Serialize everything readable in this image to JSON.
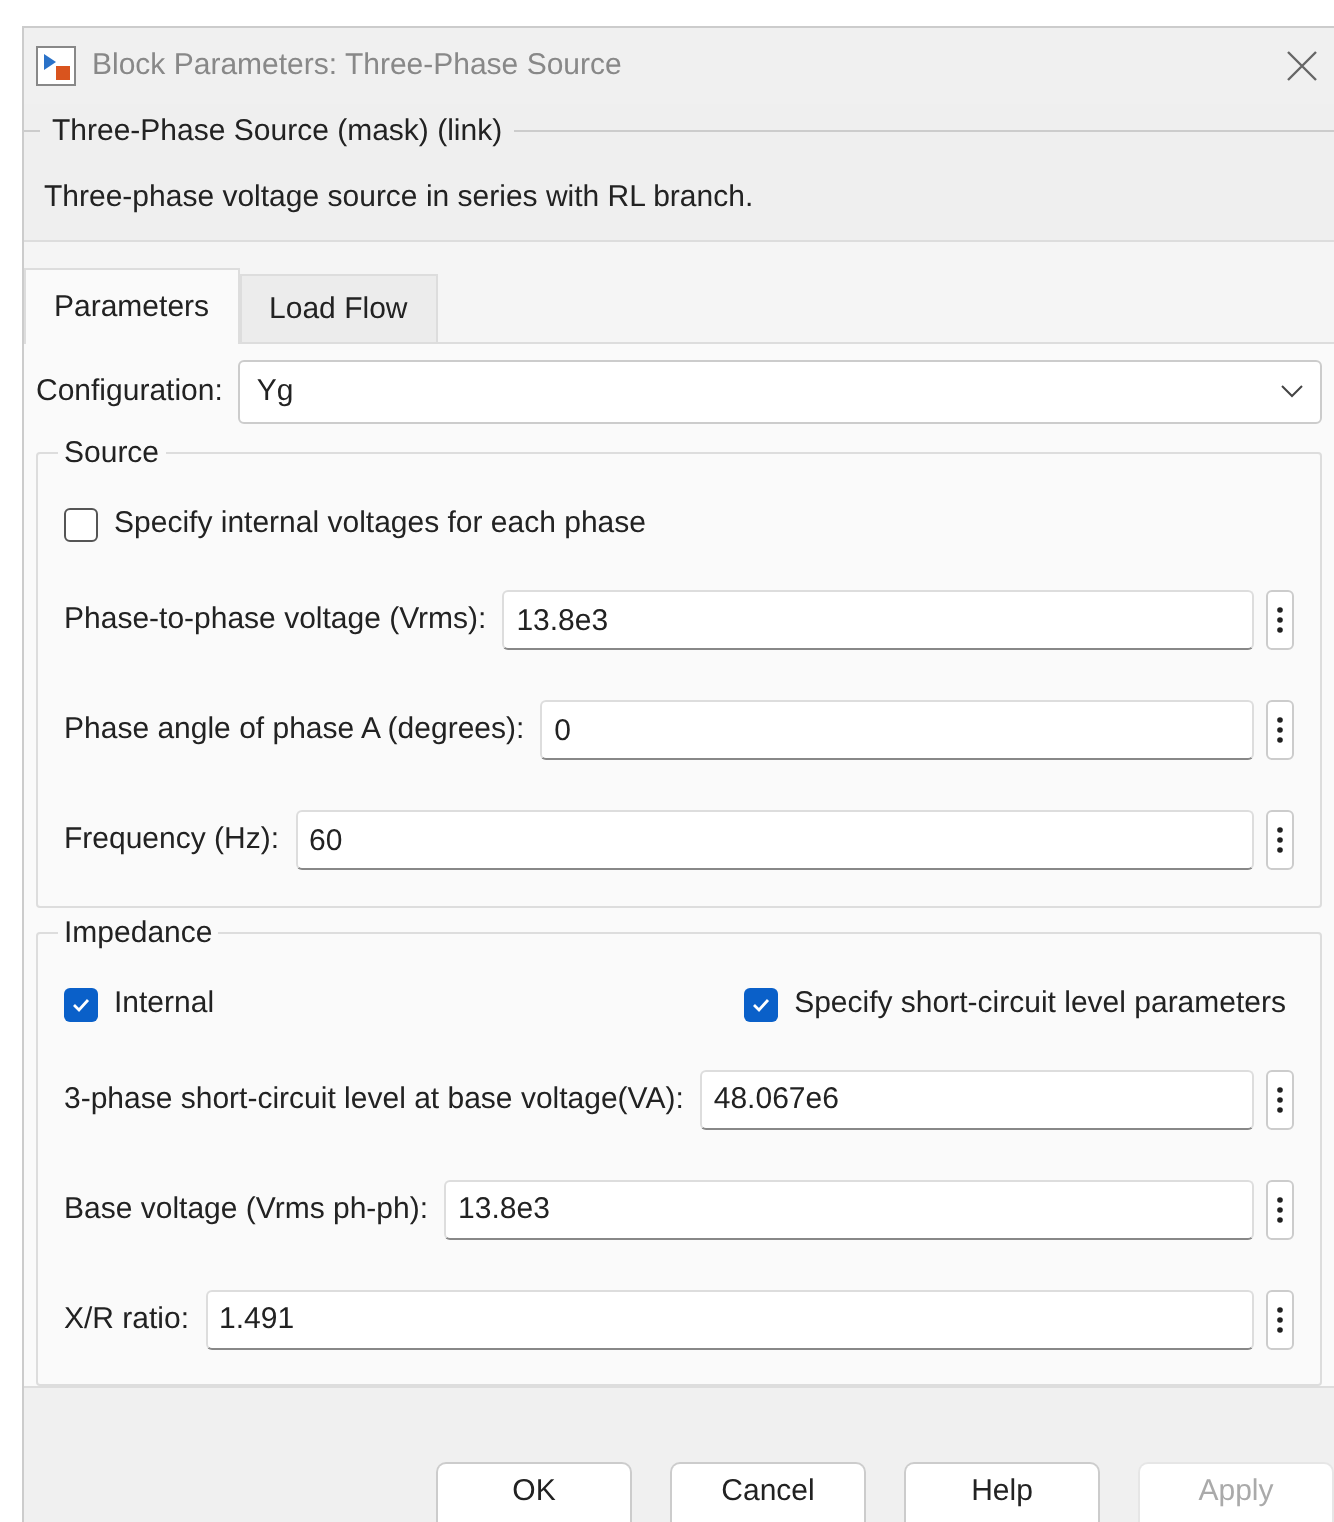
{
  "window": {
    "title": "Block Parameters: Three-Phase Source"
  },
  "header": {
    "title": "Three-Phase Source (mask) (link)",
    "description": "Three-phase voltage source in series with RL branch."
  },
  "tabs": [
    {
      "label": "Parameters",
      "selected": true
    },
    {
      "label": "Load Flow",
      "selected": false
    }
  ],
  "configuration": {
    "label": "Configuration:",
    "value": "Yg"
  },
  "groups": [
    {
      "title": "Source",
      "checkboxes": [
        {
          "label": "Specify internal voltages for each phase",
          "checked": false
        }
      ],
      "fields": [
        {
          "label": "Phase-to-phase voltage (Vrms):",
          "value": "13.8e3"
        },
        {
          "label": "Phase angle of phase A (degrees):",
          "value": "0"
        },
        {
          "label": "Frequency (Hz):",
          "value": "60"
        }
      ]
    },
    {
      "title": "Impedance",
      "checkboxes": [
        {
          "label": "Internal",
          "checked": true
        },
        {
          "label": "Specify short-circuit level parameters",
          "checked": true
        }
      ],
      "fields": [
        {
          "label": "3-phase short-circuit level at base voltage(VA):",
          "value": "48.067e6"
        },
        {
          "label": "Base voltage (Vrms ph-ph):",
          "value": "13.8e3"
        },
        {
          "label": "X/R ratio:",
          "value": "1.491"
        }
      ]
    }
  ],
  "buttons": [
    {
      "label": "OK",
      "disabled": false
    },
    {
      "label": "Cancel",
      "disabled": false
    },
    {
      "label": "Help",
      "disabled": false
    },
    {
      "label": "Apply",
      "disabled": true
    }
  ]
}
